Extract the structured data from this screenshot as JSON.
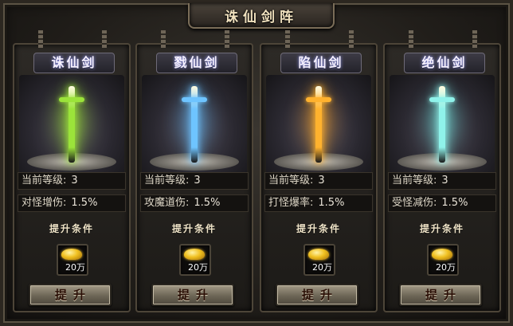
{
  "window": {
    "title": "诛仙剑阵",
    "close_symbol": "✕"
  },
  "panels": [
    {
      "name": "诛仙剑",
      "glow_color": "#a8ff2a",
      "blade_color": "#9be33a",
      "level_label": "当前等级:",
      "level_value": "3",
      "bonus_label": "对怪增伤:",
      "bonus_value": "1.5%",
      "condition_label": "提升条件",
      "cost_qty": "20万",
      "button_label": "提升"
    },
    {
      "name": "戮仙剑",
      "glow_color": "#5ab8ff",
      "blade_color": "#6ec4ff",
      "level_label": "当前等级:",
      "level_value": "3",
      "bonus_label": "攻魔道伤:",
      "bonus_value": "1.5%",
      "condition_label": "提升条件",
      "cost_qty": "20万",
      "button_label": "提升"
    },
    {
      "name": "陷仙剑",
      "glow_color": "#ff9a1a",
      "blade_color": "#ffb22e",
      "level_label": "当前等级:",
      "level_value": "3",
      "bonus_label": "打怪爆率:",
      "bonus_value": "1.5%",
      "condition_label": "提升条件",
      "cost_qty": "20万",
      "button_label": "提升"
    },
    {
      "name": "绝仙剑",
      "glow_color": "#5ef0e8",
      "blade_color": "#8ff2ea",
      "level_label": "当前等级:",
      "level_value": "3",
      "bonus_label": "受怪减伤:",
      "bonus_value": "1.5%",
      "condition_label": "提升条件",
      "cost_qty": "20万",
      "button_label": "提升"
    }
  ]
}
